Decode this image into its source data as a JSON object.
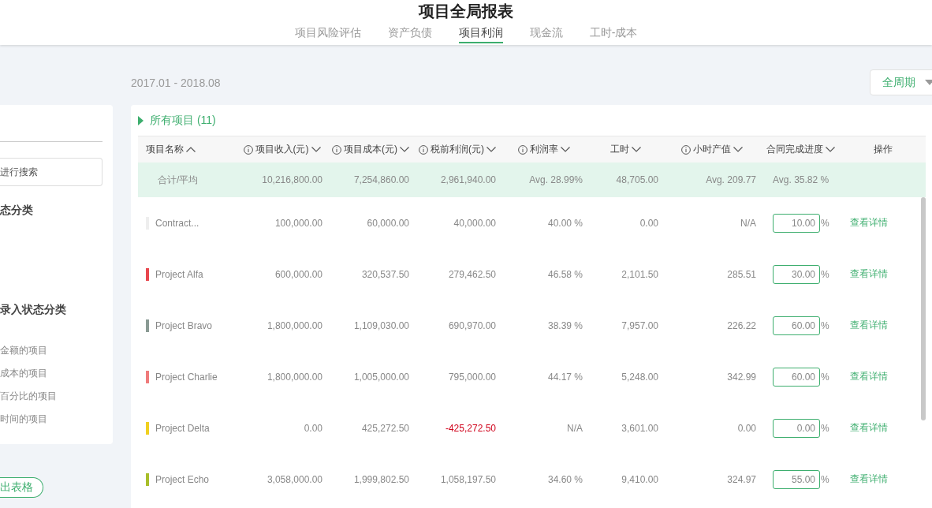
{
  "header": {
    "title": "项目全局报表",
    "tabs": [
      {
        "label": "项目风险评估",
        "selected": false
      },
      {
        "label": "资产负债",
        "selected": false
      },
      {
        "label": "项目利润",
        "selected": true
      },
      {
        "label": "现金流",
        "selected": false
      },
      {
        "label": "工时-成本",
        "selected": false
      }
    ]
  },
  "period": "2017.01 - 2018.08",
  "range_dropdown": "全周期",
  "sidebar": {
    "search_placeholder": "进行搜索",
    "section_1": "态分类",
    "section_2": "录入状态分类",
    "filters": [
      "金额的项目",
      "成本的项目",
      "百分比的项目",
      "时间的项目"
    ],
    "export_button": "出表格"
  },
  "table": {
    "group_label": "所有项目 (11)",
    "columns": [
      {
        "label": "项目名称",
        "info": false,
        "sortable": true,
        "ascending": true
      },
      {
        "label": "项目收入(元)",
        "info": true,
        "sortable": true,
        "ascending": false
      },
      {
        "label": "项目成本(元)",
        "info": true,
        "sortable": true,
        "ascending": false
      },
      {
        "label": "税前利润(元)",
        "info": true,
        "sortable": true,
        "ascending": false
      },
      {
        "label": "利润率",
        "info": true,
        "sortable": true,
        "ascending": false
      },
      {
        "label": "工时",
        "info": false,
        "sortable": true,
        "ascending": false
      },
      {
        "label": "小时产值",
        "info": true,
        "sortable": true,
        "ascending": false
      },
      {
        "label": "合同完成进度",
        "info": false,
        "sortable": true,
        "ascending": false
      },
      {
        "label": "操作",
        "info": false,
        "sortable": false
      }
    ],
    "total": {
      "label": "合计/平均",
      "revenue": "10,216,800.00",
      "cost": "7,254,860.00",
      "profit": "2,961,940.00",
      "rate": "Avg. 28.99%",
      "hours": "48,705.00",
      "hourly": "Avg. 209.77",
      "progress": "Avg. 35.82 %"
    },
    "rows": [
      {
        "name": "Contract...",
        "color": "#eeeeee",
        "revenue": "100,000.00",
        "cost": "60,000.00",
        "profit": "40,000.00",
        "profit_loss": false,
        "rate": "40.00 %",
        "hours": "0.00",
        "hourly": "N/A",
        "progress": "10.00",
        "unit": "%",
        "action": "查看详情"
      },
      {
        "name": "Project Alfa",
        "color": "#e8474e",
        "revenue": "600,000.00",
        "cost": "320,537.50",
        "profit": "279,462.50",
        "profit_loss": false,
        "rate": "46.58 %",
        "hours": "2,101.50",
        "hourly": "285.51",
        "progress": "30.00",
        "unit": "%",
        "action": "查看详情"
      },
      {
        "name": "Project Bravo",
        "color": "#8a9a94",
        "revenue": "1,800,000.00",
        "cost": "1,109,030.00",
        "profit": "690,970.00",
        "profit_loss": false,
        "rate": "38.39 %",
        "hours": "7,957.00",
        "hourly": "226.22",
        "progress": "60.00",
        "unit": "%",
        "action": "查看详情"
      },
      {
        "name": "Project Charlie",
        "color": "#ef7b7b",
        "revenue": "1,800,000.00",
        "cost": "1,005,000.00",
        "profit": "795,000.00",
        "profit_loss": false,
        "rate": "44.17 %",
        "hours": "5,248.00",
        "hourly": "342.99",
        "progress": "60.00",
        "unit": "%",
        "action": "查看详情"
      },
      {
        "name": "Project Delta",
        "color": "#f0d020",
        "revenue": "0.00",
        "cost": "425,272.50",
        "profit": "-425,272.50",
        "profit_loss": true,
        "rate": "N/A",
        "hours": "3,601.00",
        "hourly": "0.00",
        "progress": "0.00",
        "unit": "%",
        "action": "查看详情"
      },
      {
        "name": "Project Echo",
        "color": "#a8be2a",
        "revenue": "3,058,000.00",
        "cost": "1,999,802.50",
        "profit": "1,058,197.50",
        "profit_loss": false,
        "rate": "34.60 %",
        "hours": "9,410.00",
        "hourly": "324.97",
        "progress": "55.00",
        "unit": "%",
        "action": "查看详情"
      }
    ]
  }
}
